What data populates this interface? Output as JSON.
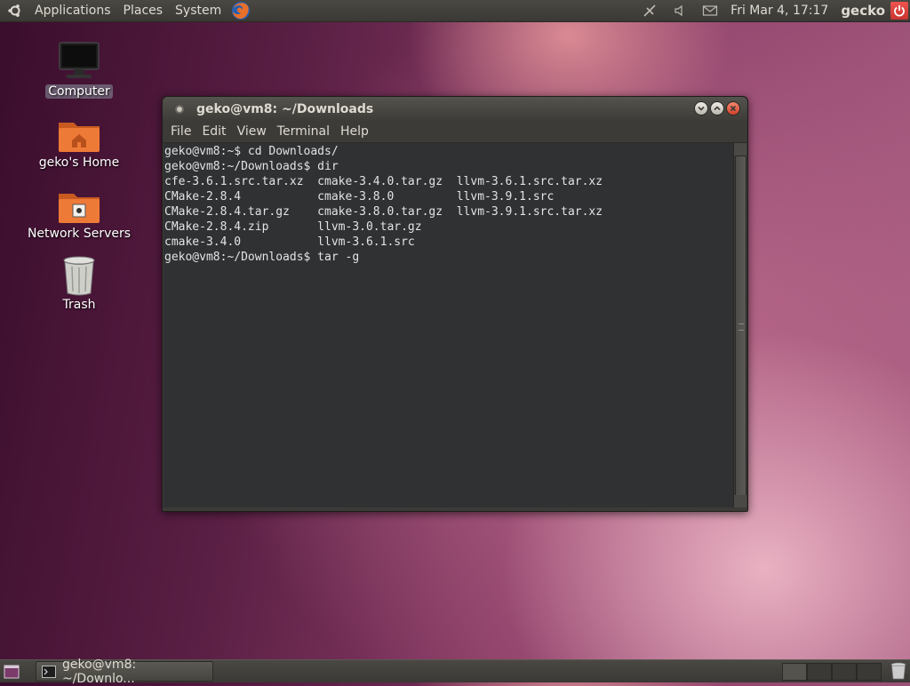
{
  "top_panel": {
    "menus": [
      "Applications",
      "Places",
      "System"
    ],
    "clock": "Fri Mar  4, 17:17",
    "user": "gecko"
  },
  "desktop": {
    "icons": [
      {
        "label": "Computer",
        "icon": "computer-icon",
        "selected": true
      },
      {
        "label": "geko's Home",
        "icon": "home-folder-icon",
        "selected": false
      },
      {
        "label": "Network Servers",
        "icon": "network-folder-icon",
        "selected": false
      },
      {
        "label": "Trash",
        "icon": "trash-icon",
        "selected": false
      }
    ]
  },
  "terminal": {
    "title": "geko@vm8: ~/Downloads",
    "menu": [
      "File",
      "Edit",
      "View",
      "Terminal",
      "Help"
    ],
    "lines": [
      "geko@vm8:~$ cd Downloads/",
      "geko@vm8:~/Downloads$ dir",
      "cfe-3.6.1.src.tar.xz  cmake-3.4.0.tar.gz  llvm-3.6.1.src.tar.xz",
      "CMake-2.8.4           cmake-3.8.0         llvm-3.9.1.src",
      "CMake-2.8.4.tar.gz    cmake-3.8.0.tar.gz  llvm-3.9.1.src.tar.xz",
      "CMake-2.8.4.zip       llvm-3.0.tar.gz",
      "cmake-3.4.0           llvm-3.6.1.src",
      "geko@vm8:~/Downloads$ tar -g"
    ]
  },
  "bottom_panel": {
    "task_label": "geko@vm8: ~/Downlo..."
  },
  "colors": {
    "panel": "#3c3b37",
    "terminal_bg": "#2f3133",
    "close_button": "#d1422a"
  }
}
